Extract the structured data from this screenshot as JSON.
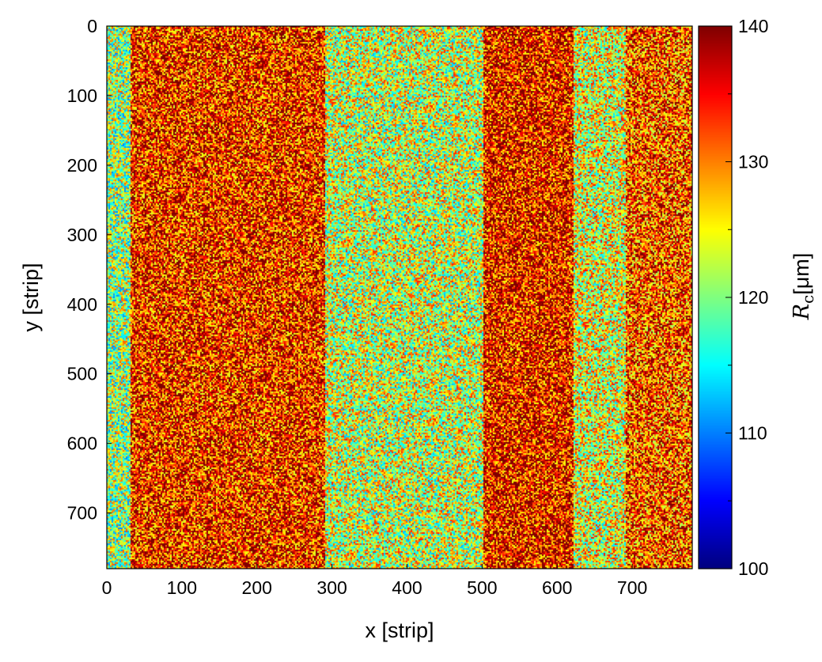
{
  "chart_data": {
    "type": "heatmap",
    "xlabel": "x [strip]",
    "ylabel": "y [strip]",
    "xlim": [
      0,
      780
    ],
    "ylim": [
      0,
      780
    ],
    "y_inverted": true,
    "x_ticks": [
      0,
      100,
      200,
      300,
      400,
      500,
      600,
      700
    ],
    "y_ticks": [
      0,
      100,
      200,
      300,
      400,
      500,
      600,
      700
    ],
    "colorbar": {
      "label_symbol": "R",
      "label_subscript": "c",
      "label_unit": "[μm]",
      "range": [
        100,
        140
      ],
      "ticks": [
        100,
        110,
        120,
        130,
        140
      ],
      "colormap": "jet"
    },
    "regions": [
      {
        "x": [
          0,
          30
        ],
        "y": [
          0,
          780
        ],
        "value": 121
      },
      {
        "x": [
          30,
          290
        ],
        "y": [
          0,
          780
        ],
        "value": 134
      },
      {
        "x": [
          290,
          500
        ],
        "y": [
          0,
          780
        ],
        "value": 123
      },
      {
        "x": [
          500,
          620
        ],
        "y": [
          0,
          780
        ],
        "value": 135
      },
      {
        "x": [
          620,
          690
        ],
        "y": [
          0,
          780
        ],
        "value": 124
      },
      {
        "x": [
          690,
          780
        ],
        "y": [
          0,
          780
        ],
        "value": 132
      }
    ]
  }
}
